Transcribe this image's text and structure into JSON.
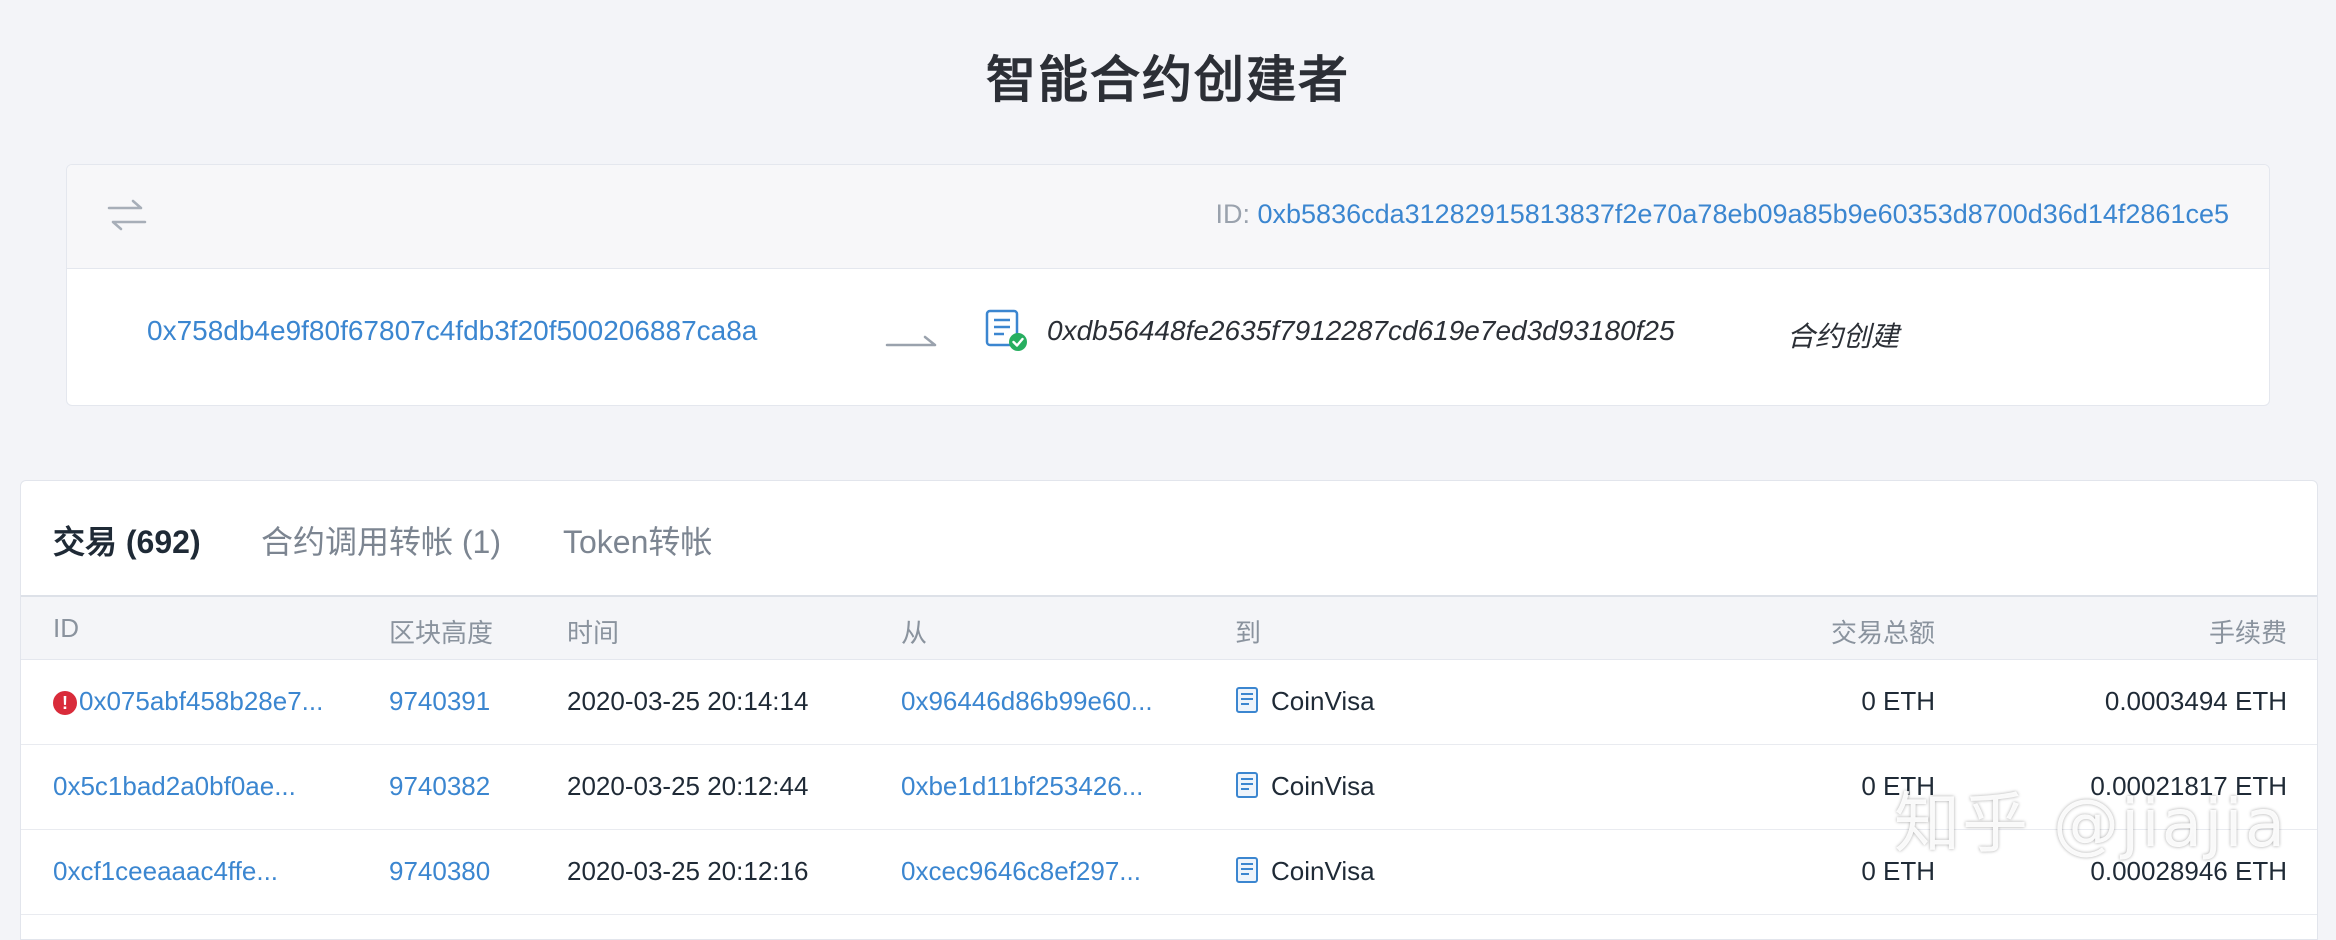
{
  "page": {
    "title": "智能合约创建者"
  },
  "creation": {
    "id_label": "ID:",
    "id_value": "0xb5836cda31282915813837f2e70a78eb09a85b9e60353d8700d36d14f2861ce5",
    "from": "0x758db4e9f80f67807c4fdb3f20f500206887ca8a",
    "to": "0xdb56448fe2635f7912287cd619e7ed3d93180f25",
    "type": "合约创建",
    "icons": {
      "header": "swap-arrows-icon",
      "arrow": "right-arrow-icon",
      "contract": "contract-verified-icon"
    }
  },
  "tabs": [
    {
      "label": "交易 (692)",
      "active": true
    },
    {
      "label": "合约调用转帐 (1)",
      "active": false
    },
    {
      "label": "Token转帐",
      "active": false
    }
  ],
  "table": {
    "headers": {
      "id": "ID",
      "block": "区块高度",
      "time": "时间",
      "from": "从",
      "to": "到",
      "amount": "交易总额",
      "fee": "手续费"
    },
    "rows": [
      {
        "error": true,
        "error_glyph": "!",
        "id": "0x075abf458b28e7...",
        "block": "9740391",
        "time": "2020-03-25 20:14:14",
        "from": "0x96446d86b99e60...",
        "to": "CoinVisa",
        "amount": "0 ETH",
        "fee": "0.0003494 ETH"
      },
      {
        "error": false,
        "id": "0x5c1bad2a0bf0ae...",
        "block": "9740382",
        "time": "2020-03-25 20:12:44",
        "from": "0xbe1d11bf253426...",
        "to": "CoinVisa",
        "amount": "0 ETH",
        "fee": "0.00021817 ETH"
      },
      {
        "error": false,
        "id": "0xcf1ceeaaac4ffe...",
        "block": "9740380",
        "time": "2020-03-25 20:12:16",
        "from": "0xcec9646c8ef297...",
        "to": "CoinVisa",
        "amount": "0 ETH",
        "fee": "0.00028946 ETH"
      }
    ]
  },
  "watermark": "知乎 @jiajia",
  "colors": {
    "link": "#3b86d0",
    "error": "#d92b3a",
    "background": "#f3f4f8"
  }
}
